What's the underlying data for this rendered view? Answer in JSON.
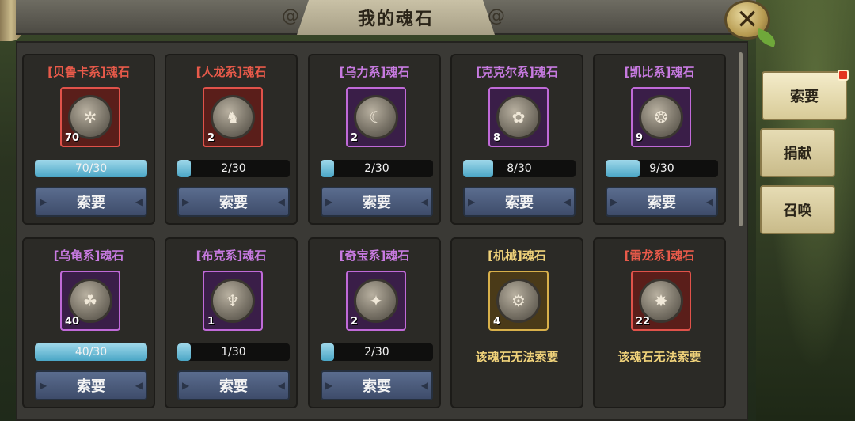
{
  "window": {
    "title": "我的魂石"
  },
  "colors": {
    "red": "#e85a4a",
    "purple": "#c77ae0",
    "gold": "#f0d27a",
    "accent_bar": "#6cc4dc"
  },
  "cards": [
    {
      "title": "[贝鲁卡系]魂石",
      "rarity": "red",
      "count": "70",
      "progress_text": "70/30",
      "progress": 1.0,
      "icon": "beetle-icon",
      "button": "索要"
    },
    {
      "title": "[人龙系]魂石",
      "rarity": "red",
      "count": "2",
      "progress_text": "2/30",
      "progress": 0.067,
      "icon": "dragon-icon",
      "button": "索要"
    },
    {
      "title": "[乌力系]魂石",
      "rarity": "purple",
      "count": "2",
      "progress_text": "2/30",
      "progress": 0.067,
      "icon": "fish-icon",
      "button": "索要"
    },
    {
      "title": "[克克尔系]魂石",
      "rarity": "purple",
      "count": "8",
      "progress_text": "8/30",
      "progress": 0.267,
      "icon": "pup-icon",
      "button": "索要"
    },
    {
      "title": "[凯比系]魂石",
      "rarity": "purple",
      "count": "9",
      "progress_text": "9/30",
      "progress": 0.3,
      "icon": "pig-icon",
      "button": "索要"
    },
    {
      "title": "[乌龟系]魂石",
      "rarity": "purple",
      "count": "40",
      "progress_text": "40/30",
      "progress": 1.0,
      "icon": "turtle-icon",
      "button": "索要"
    },
    {
      "title": "[布克系]魂石",
      "rarity": "purple",
      "count": "1",
      "progress_text": "1/30",
      "progress": 0.033,
      "icon": "shark-icon",
      "button": "索要"
    },
    {
      "title": "[奇宝系]魂石",
      "rarity": "purple",
      "count": "2",
      "progress_text": "2/30",
      "progress": 0.067,
      "icon": "rabbit-icon",
      "button": "索要"
    },
    {
      "title": "[机械]魂石",
      "rarity": "gold",
      "count": "4",
      "icon": "mech-icon",
      "unavailable": "该魂石无法索要"
    },
    {
      "title": "[雷龙系]魂石",
      "rarity": "red",
      "count": "22",
      "icon": "thunder-icon",
      "unavailable": "该魂石无法索要"
    }
  ],
  "side_tabs": [
    {
      "label": "索要",
      "active": true,
      "badge": true
    },
    {
      "label": "捐献",
      "active": false
    },
    {
      "label": "召唤",
      "active": false
    }
  ],
  "close_icon": "close-icon"
}
